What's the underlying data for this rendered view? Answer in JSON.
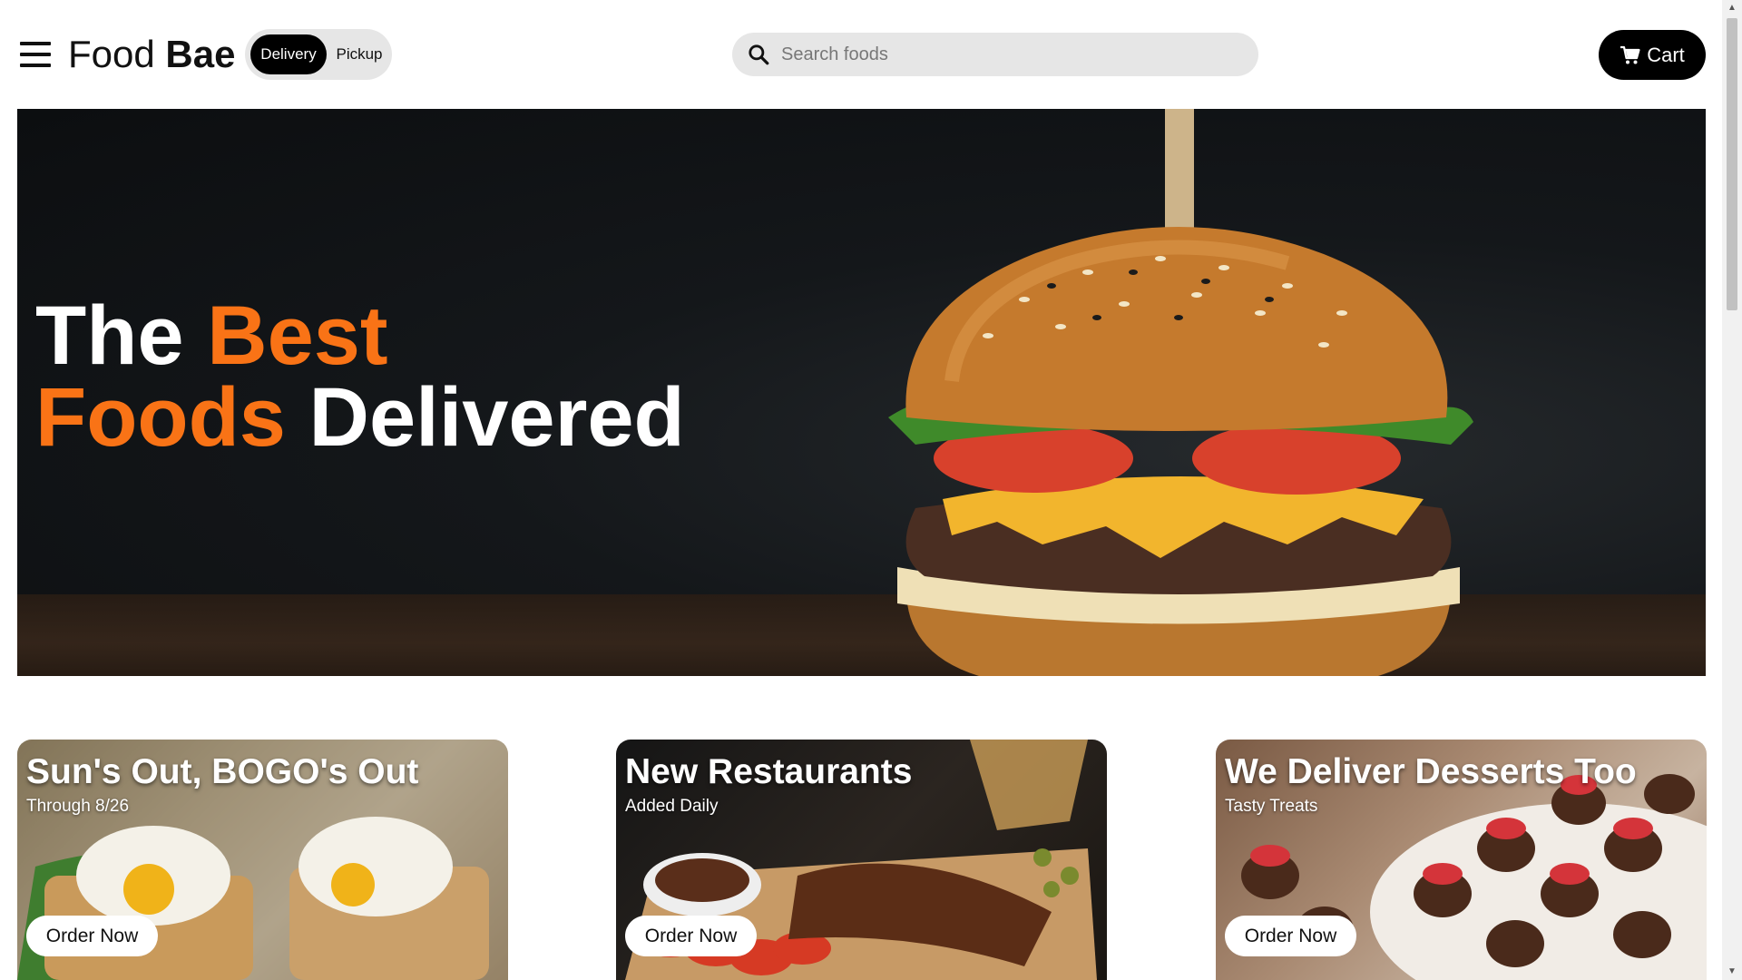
{
  "header": {
    "brand_light": "Food",
    "brand_bold": "Bae",
    "mode_options": [
      "Delivery",
      "Pickup"
    ],
    "mode_selected": "Delivery",
    "search_placeholder": "Search foods",
    "search_value": "",
    "cart_label": "Cart",
    "icons": {
      "menu": "hamburger-menu-icon",
      "search": "magnifier-icon",
      "cart": "shopping-cart-icon"
    }
  },
  "hero": {
    "line1_white": "The",
    "line1_accent": "Best",
    "line2_accent": "Foods",
    "line2_white": "Delivered",
    "accent_color": "#f97316"
  },
  "promos": [
    {
      "title": "Sun's Out, BOGO's Out",
      "subtitle": "Through 8/26",
      "button": "Order Now"
    },
    {
      "title": "New Restaurants",
      "subtitle": "Added Daily",
      "button": "Order Now"
    },
    {
      "title": "We Deliver Desserts Too",
      "subtitle": "Tasty Treats",
      "button": "Order Now"
    }
  ]
}
